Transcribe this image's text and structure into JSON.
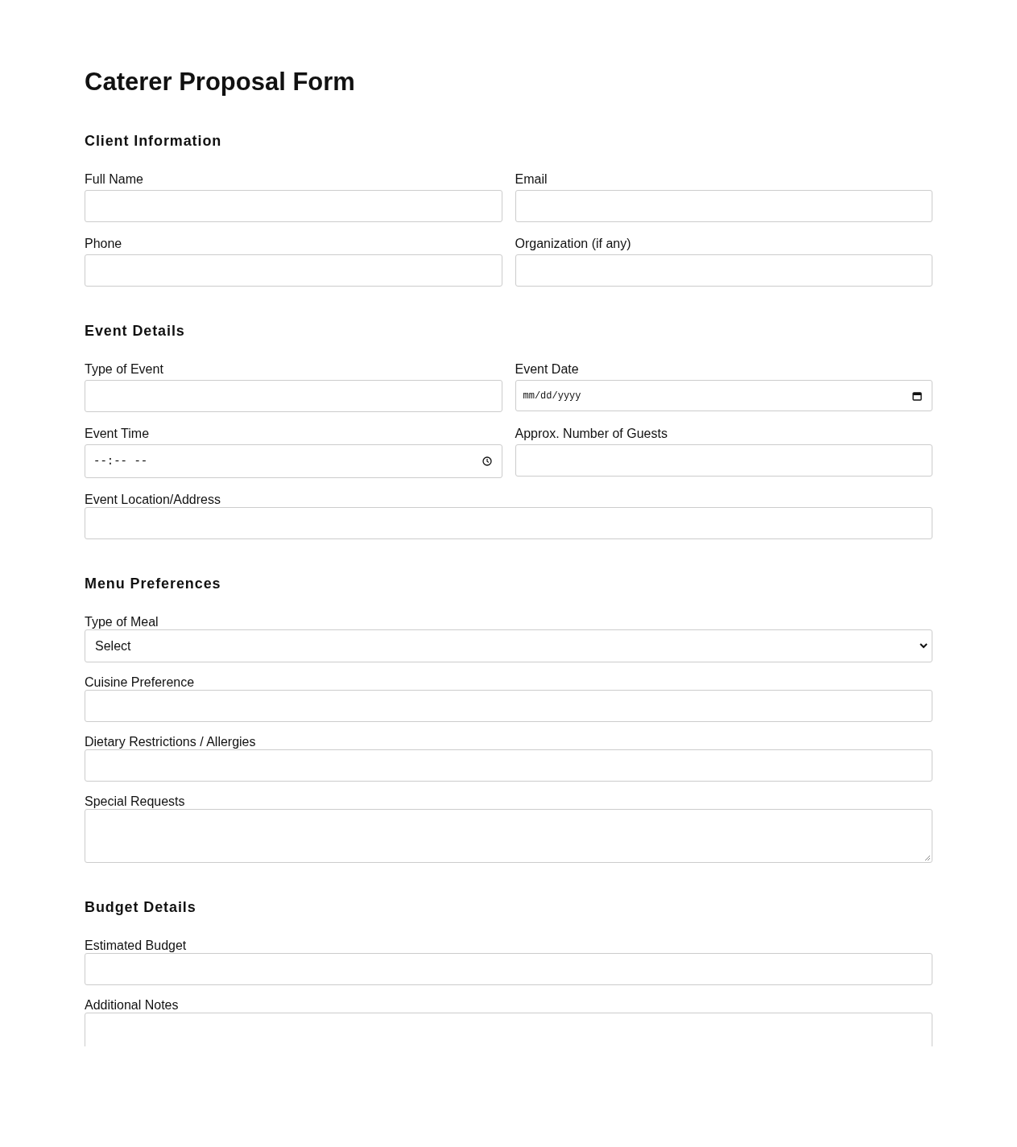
{
  "title": "Caterer Proposal Form",
  "sections": [
    {
      "heading": "Client Information",
      "rows": [
        [
          {
            "label": "Full Name",
            "kind": "text"
          },
          {
            "label": "Email",
            "kind": "text"
          }
        ],
        [
          {
            "label": "Phone",
            "kind": "text"
          },
          {
            "label": "Organization (if any)",
            "kind": "text"
          }
        ]
      ]
    },
    {
      "heading": "Event Details",
      "rows": [
        [
          {
            "label": "Type of Event",
            "kind": "text"
          },
          {
            "label": "Event Date",
            "kind": "date",
            "placeholder": "mm/dd/yyyy"
          }
        ],
        [
          {
            "label": "Event Time",
            "kind": "time",
            "placeholder": "--:-- --"
          },
          {
            "label": "Approx. Number of Guests",
            "kind": "text"
          }
        ],
        [
          {
            "label": "Event Location/Address",
            "kind": "text"
          }
        ]
      ]
    },
    {
      "heading": "Menu Preferences",
      "rows": [
        [
          {
            "label": "Type of Meal",
            "kind": "select",
            "value": "Select"
          }
        ],
        [
          {
            "label": "Cuisine Preference",
            "kind": "text"
          }
        ],
        [
          {
            "label": "Dietary Restrictions / Allergies",
            "kind": "text"
          }
        ],
        [
          {
            "label": "Special Requests",
            "kind": "textarea"
          }
        ]
      ]
    },
    {
      "heading": "Budget Details",
      "rows": [
        [
          {
            "label": "Estimated Budget",
            "kind": "text"
          }
        ],
        [
          {
            "label": "Additional Notes",
            "kind": "textarea"
          }
        ]
      ]
    }
  ]
}
